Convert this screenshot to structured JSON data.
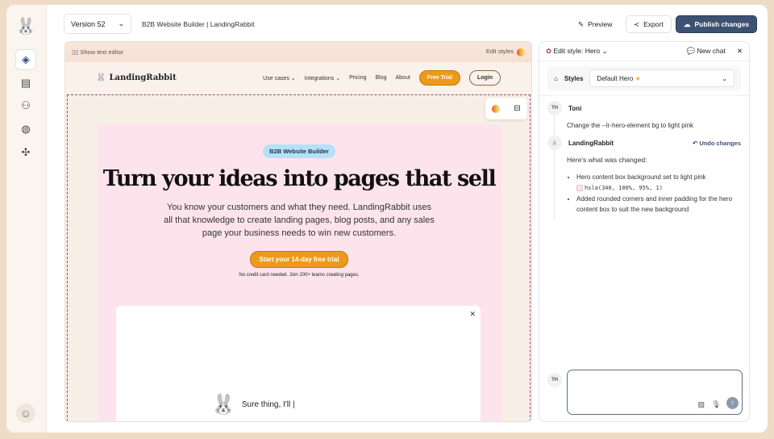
{
  "sidebar": {
    "items": [
      "layers",
      "pages",
      "users",
      "globe",
      "integrations"
    ]
  },
  "header": {
    "version": "Version 52",
    "title": "B2B Website Builder | LandingRabbit",
    "preview": "Preview",
    "export": "Export",
    "publish": "Publish changes"
  },
  "canvas": {
    "show_text_editor": "Show text editor",
    "edit_styles": "Edit styles",
    "site": {
      "brand": "LandingRabbit",
      "nav": [
        "Use cases",
        "Integrations",
        "Pricing",
        "Blog",
        "About"
      ],
      "free_trial": "Free Trial",
      "login": "Login"
    },
    "hero": {
      "badge": "B2B Website Builder",
      "title": "Turn your ideas into pages that sell",
      "subtitle": "You know your customers and what they need. LandingRabbit uses all that knowledge to create landing pages, blog posts, and any sales page your business needs to win new customers.",
      "cta": "Start your 14-day free trial",
      "note": "No credit card needed. Join 200+ teams creating pages."
    },
    "modal": {
      "message": "Sure thing, I'll |"
    }
  },
  "panel": {
    "title": "Edit style: Hero",
    "new_chat": "New chat",
    "styles_label": "Styles",
    "style_value": "Default Hero",
    "messages": [
      {
        "initials": "TH",
        "author": "Toni",
        "text": "Change the --lr-hero-element bg to light pink"
      },
      {
        "author": "LandingRabbit",
        "undo": "Undo changes",
        "intro": "Here's what was changed:",
        "bullets": [
          "Hero content box background set to light pink",
          "Added rounded corners and inner padding for the hero content box to suit the new background"
        ],
        "code": "hsla(340, 100%, 95%, 1)"
      }
    ],
    "input_initials": "TH",
    "input_value": ""
  },
  "colors": {
    "publish": "#3d5273",
    "hero_bg": "#fde4ec",
    "cta": "#eb9a1c"
  }
}
